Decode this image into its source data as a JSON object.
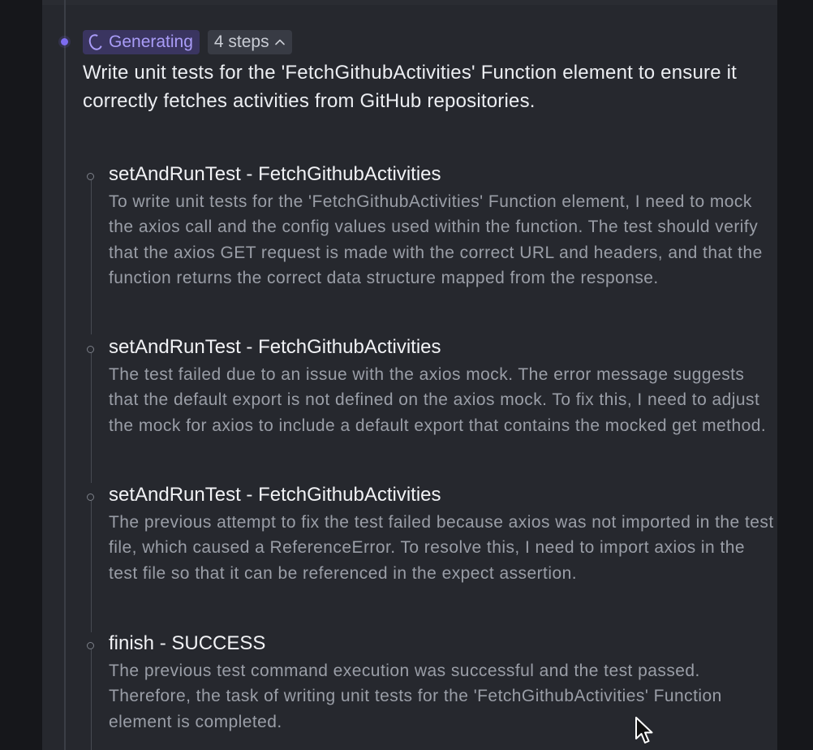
{
  "header": {
    "status_label": "Generating",
    "steps_label": "4 steps"
  },
  "task": {
    "title": "Write unit tests for the 'FetchGithubActivities' Function element to ensure it correctly fetches activities from GitHub repositories."
  },
  "steps": [
    {
      "title": "setAndRunTest - FetchGithubActivities",
      "description": "To write unit tests for the 'FetchGithubActivities' Function element, I need to mock the axios call and the config values used within the function. The test should verify that the axios GET request is made with the correct URL and headers, and that the function returns the correct data structure mapped from the response."
    },
    {
      "title": "setAndRunTest - FetchGithubActivities",
      "description": "The test failed due to an issue with the axios mock. The error message suggests that the default export is not defined on the axios mock. To fix this, I need to adjust the mock for axios to include a default export that contains the mocked get method."
    },
    {
      "title": "setAndRunTest - FetchGithubActivities",
      "description": "The previous attempt to fix the test failed because axios was not imported in the test file, which caused a ReferenceError. To resolve this, I need to import axios in the test file so that it can be referenced in the expect assertion."
    },
    {
      "title": "finish - SUCCESS",
      "description": "The previous test command execution was successful and the test passed. Therefore, the task of writing unit tests for the 'FetchGithubActivities' Function element is completed."
    }
  ],
  "colors": {
    "accent": "#7d6cf0",
    "panel_bg": "#26282e",
    "page_bg": "#16171b"
  },
  "icons": {
    "status": "spinner-icon",
    "toggle": "chevron-up-icon",
    "pointer": "cursor-icon"
  }
}
